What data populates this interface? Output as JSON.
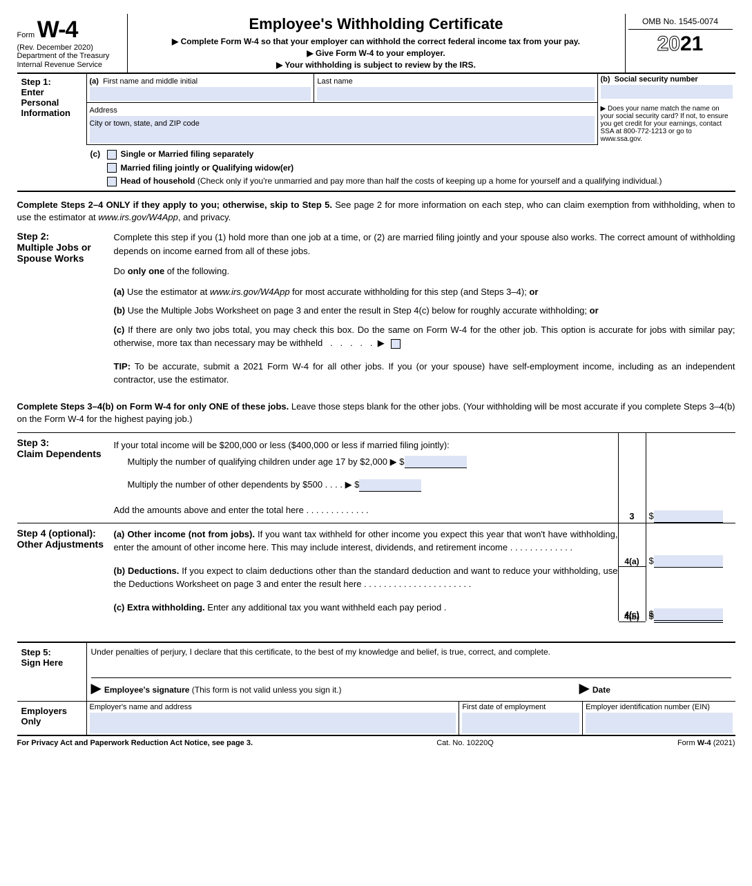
{
  "header": {
    "form_prefix": "Form",
    "form_number": "W-4",
    "revision": "(Rev. December 2020)",
    "department": "Department of the Treasury",
    "irs": "Internal Revenue Service",
    "title": "Employee's Withholding Certificate",
    "sub1": "▶ Complete Form W-4 so that your employer can withhold the correct federal income tax from your pay.",
    "sub2": "▶ Give Form W-4 to your employer.",
    "sub3": "▶ Your withholding is subject to review by the IRS.",
    "omb": "OMB No. 1545-0074",
    "year_outline": "20",
    "year_bold": "21"
  },
  "step1": {
    "label": "Step 1:",
    "label2": "Enter Personal Information",
    "a_label": "(a)",
    "first_name": "First name and middle initial",
    "last_name": "Last name",
    "b_label": "(b)",
    "ssn": "Social security number",
    "address": "Address",
    "city": "City or town, state, and ZIP code",
    "name_match": "▶ Does your name match the name on your social security card? If not, to ensure you get credit for your earnings, contact SSA at 800-772-1213 or go to www.ssa.gov.",
    "c_label": "(c)",
    "single": "Single or Married filing separately",
    "joint": "Married filing jointly or Qualifying widow(er)",
    "hoh": "Head of household (Check only if you're unmarried and pay more than half the costs of keeping up a home for yourself and a qualifying individual.)"
  },
  "instructions": {
    "complete24": "Complete Steps 2–4 ONLY if they apply to you; otherwise, skip to Step 5. See page 2 for more information on each step, who can claim exemption from withholding, when to use the estimator at www.irs.gov/W4App, and privacy."
  },
  "step2": {
    "label": "Step 2:",
    "label2": "Multiple Jobs or Spouse Works",
    "intro": "Complete this step if you (1) hold more than one job at a time, or (2) are married filing jointly and your spouse also works. The correct amount of withholding depends on income earned from all of these jobs.",
    "do_one": "Do only one of the following.",
    "opt_a": "(a) Use the estimator at www.irs.gov/W4App for most accurate withholding for this step (and Steps 3–4); or",
    "opt_b": "(b) Use the Multiple Jobs Worksheet on page 3 and enter the result in Step 4(c) below for roughly accurate withholding; or",
    "opt_c": "(c) If there are only two jobs total, you may check this box. Do the same on Form W-4 for the other job. This option is accurate for jobs with similar pay; otherwise, more tax than necessary may be withheld   .   .   .   .   .   ▶",
    "tip": "TIP: To be accurate, submit a 2021 Form W-4 for all other jobs. If you (or your spouse) have self-employment income, including as an independent contractor, use the estimator."
  },
  "instructions2": {
    "complete34b": "Complete Steps 3–4(b) on Form W-4 for only ONE of these jobs. Leave those steps blank for the other jobs. (Your withholding will be most accurate if you complete Steps 3–4(b) on the Form W-4 for the highest paying job.)"
  },
  "step3": {
    "label": "Step 3:",
    "label2": "Claim Dependents",
    "intro": "If your total income will be $200,000 or less ($400,000 or less if married filing jointly):",
    "children": "Multiply the number of qualifying children under age 17 by $2,000 ▶",
    "other_dep": "Multiply the number of other dependents by $500    .    .    .   . ▶",
    "add": "Add the amounts above and enter the total here    .   .   .   .   .   .   .   .   .   .   .   .   .",
    "line_num": "3",
    "dollar": "$"
  },
  "step4": {
    "label": "Step 4 (optional):",
    "label2": "Other Adjustments",
    "a_bold": "(a) Other income (not from jobs).",
    "a_text": " If you want tax withheld for other income you expect this year that won't have withholding, enter the amount of other income here. This may include interest, dividends, and retirement income   .   .   .   .   .   .   .   .   .   .   .   .   .",
    "a_num": "4(a)",
    "b_bold": "(b) Deductions.",
    "b_text": " If you expect to claim deductions other than the standard deduction and want to reduce your withholding, use the Deductions Worksheet on page 3 and enter the result here    .   .   .   .   .   .   .   .   .   .   .   .   .   .   .   .   .   .   .   .   .   .",
    "b_num": "4(b)",
    "c_bold": "(c) Extra withholding.",
    "c_text": " Enter any additional tax you want withheld each pay period   .",
    "c_num": "4(c)",
    "dollar": "$"
  },
  "step5": {
    "label": "Step 5:",
    "label2": "Sign Here",
    "declaration": "Under penalties of perjury, I declare that this certificate, to the best of my knowledge and belief, is true, correct, and complete.",
    "signature": "Employee's signature (This form is not valid unless you sign it.)",
    "date": "Date"
  },
  "employers": {
    "label": "Employers Only",
    "name_address": "Employer's name and address",
    "first_date": "First date of employment",
    "ein": "Employer identification number (EIN)"
  },
  "footer": {
    "privacy": "For Privacy Act and Paperwork Reduction Act Notice, see page 3.",
    "cat": "Cat. No. 10220Q",
    "form": "Form W-4 (2021)"
  }
}
